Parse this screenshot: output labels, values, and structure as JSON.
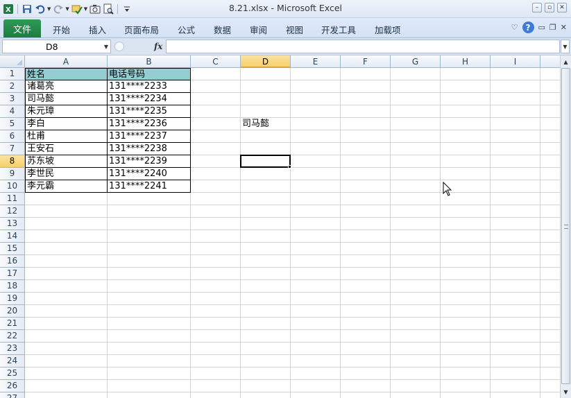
{
  "window": {
    "title": "8.21.xlsx  -  Microsoft Excel",
    "controls": {
      "minimize": "–",
      "restore": "▫",
      "close": "✕"
    }
  },
  "quick_access": {
    "icons": [
      "excel-logo-icon",
      "save-icon",
      "undo-icon",
      "redo-icon",
      "spelling-icon",
      "camera-icon",
      "print-preview-icon",
      "customize-qat-icon"
    ]
  },
  "ribbon": {
    "file_tab": "文件",
    "tabs": [
      "开始",
      "插入",
      "页面布局",
      "公式",
      "数据",
      "审阅",
      "视图",
      "开发工具",
      "加载项"
    ],
    "help": "?"
  },
  "formula_bar": {
    "name_box": "D8",
    "fx": "fx",
    "formula": ""
  },
  "sheet": {
    "columns": [
      "A",
      "B",
      "C",
      "D",
      "E",
      "F",
      "G",
      "H",
      "I"
    ],
    "selected_column": "D",
    "selected_row": 8,
    "active_cell": "D8",
    "row_numbers": [
      "1",
      "2",
      "3",
      "4",
      "5",
      "6",
      "7",
      "8",
      "9",
      "10",
      "11",
      "12",
      "13",
      "14",
      "15",
      "16",
      "17",
      "18",
      "19",
      "20",
      "21",
      "22",
      "23",
      "24",
      "25",
      "26",
      "27"
    ],
    "table": {
      "headers": [
        "姓名",
        "电话号码"
      ],
      "rows": [
        [
          "诸葛亮",
          "131****2233"
        ],
        [
          "司马懿",
          "131****2234"
        ],
        [
          "朱元璋",
          "131****2235"
        ],
        [
          "李白",
          "131****2236"
        ],
        [
          "杜甫",
          "131****2237"
        ],
        [
          "王安石",
          "131****2238"
        ],
        [
          "苏东坡",
          "131****2239"
        ],
        [
          "李世民",
          "131****2240"
        ],
        [
          "李元霸",
          "131****2241"
        ]
      ]
    },
    "cell_D5": "司马懿",
    "header_fill": "#93cdd1"
  }
}
